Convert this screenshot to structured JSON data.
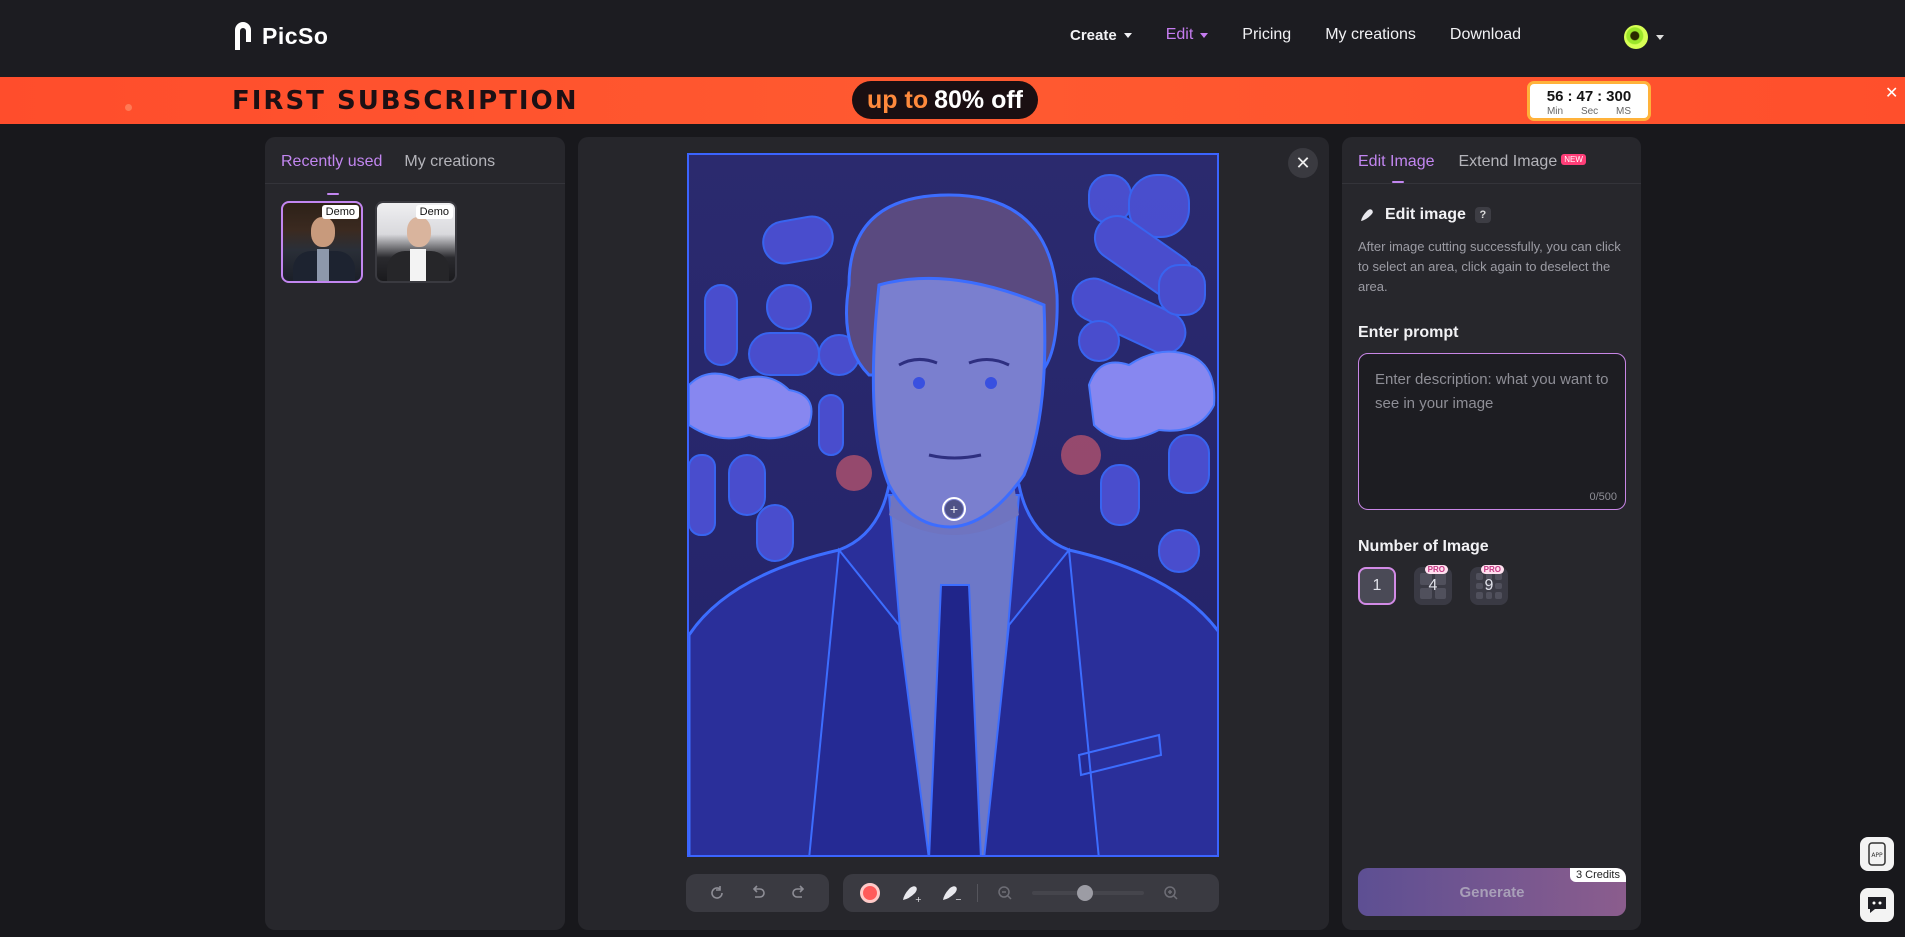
{
  "nav": {
    "logo_text": "PicSo",
    "items": [
      {
        "label": "Create",
        "has_caret": true
      },
      {
        "label": "Edit",
        "has_caret": true,
        "active": true
      },
      {
        "label": "Pricing"
      },
      {
        "label": "My creations"
      },
      {
        "label": "Download"
      }
    ],
    "avatar_icon": "avatar-icon",
    "accent_color": "#c57cf0"
  },
  "banner": {
    "title": "FIRST SUBSCRIPTION",
    "promo_prefix": "up to",
    "promo_value": "80% off",
    "countdown": {
      "min": "56",
      "sec": "47",
      "ms": "300",
      "sep": ":",
      "labels": [
        "Min",
        "Sec",
        "MS"
      ]
    },
    "close": "✕"
  },
  "left_panel": {
    "tabs": [
      "Recently used",
      "My creations"
    ],
    "active_tab": 0,
    "thumbs": [
      {
        "tag": "Demo",
        "selected": true
      },
      {
        "tag": "Demo",
        "selected": false
      }
    ]
  },
  "center": {
    "close_label": "✕",
    "brush_size": 0.47
  },
  "right_panel": {
    "tabs": [
      "Edit Image",
      "Extend Image"
    ],
    "new_badge": "NEW",
    "section_title": "Edit image",
    "help": "?",
    "description": "After image cutting successfully, you can click to select an area, click again to deselect the area.",
    "prompt_label": "Enter prompt",
    "prompt_placeholder": "Enter description: what you want to see in your image",
    "prompt_value": "",
    "counter": "0/500",
    "number_label": "Number of Image",
    "number_options": [
      {
        "value": "1",
        "pro": false,
        "selected": true
      },
      {
        "value": "4",
        "pro": true
      },
      {
        "value": "9",
        "pro": true
      }
    ],
    "pro_badge": "PRO",
    "generate_label": "Generate",
    "credits": "3 Credits"
  },
  "floating": {
    "app_label": "APP"
  }
}
